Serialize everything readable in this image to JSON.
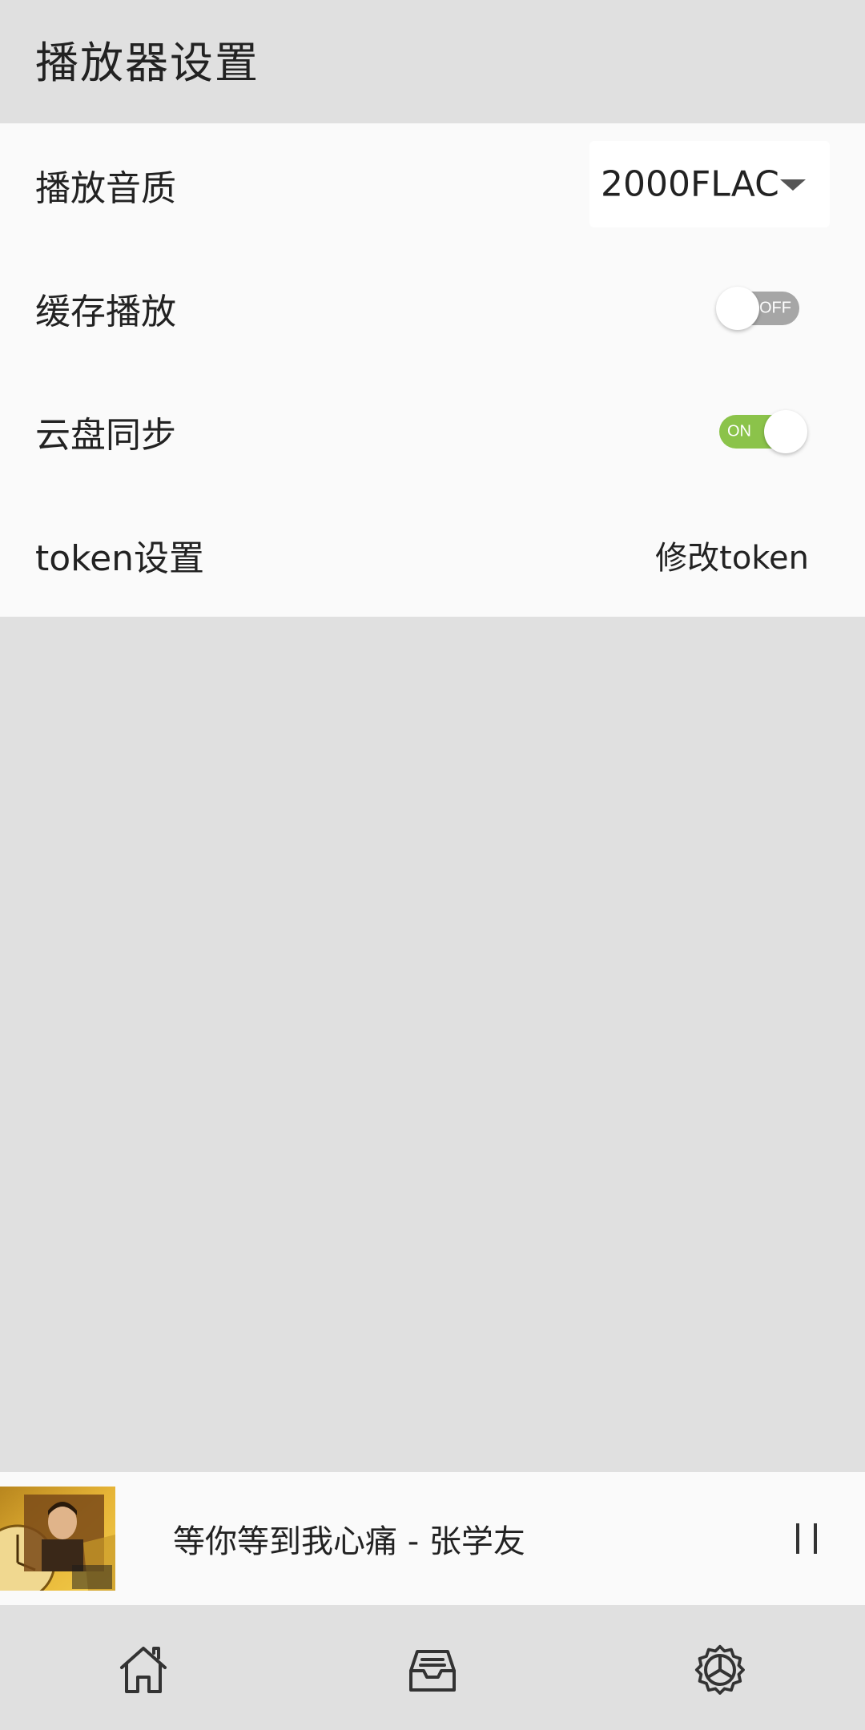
{
  "header": {
    "title": "播放器设置"
  },
  "settings": {
    "quality": {
      "label": "播放音质",
      "selected": "2000FLAC"
    },
    "cache": {
      "label": "缓存播放",
      "state": "OFF"
    },
    "cloud_sync": {
      "label": "云盘同步",
      "state": "ON"
    },
    "token": {
      "label": "token设置",
      "action": "修改token"
    }
  },
  "now_playing": {
    "title": "等你等到我心痛 - 张学友",
    "state_icon": "pause-icon"
  },
  "bottom_nav": {
    "items": [
      {
        "icon": "home-icon"
      },
      {
        "icon": "inbox-icon"
      },
      {
        "icon": "settings-gear-icon"
      }
    ]
  },
  "colors": {
    "toggle_on": "#8bc34a",
    "toggle_off": "#a6a6a6",
    "panel_bg": "#fafafa",
    "page_bg": "#e0e0e0"
  }
}
